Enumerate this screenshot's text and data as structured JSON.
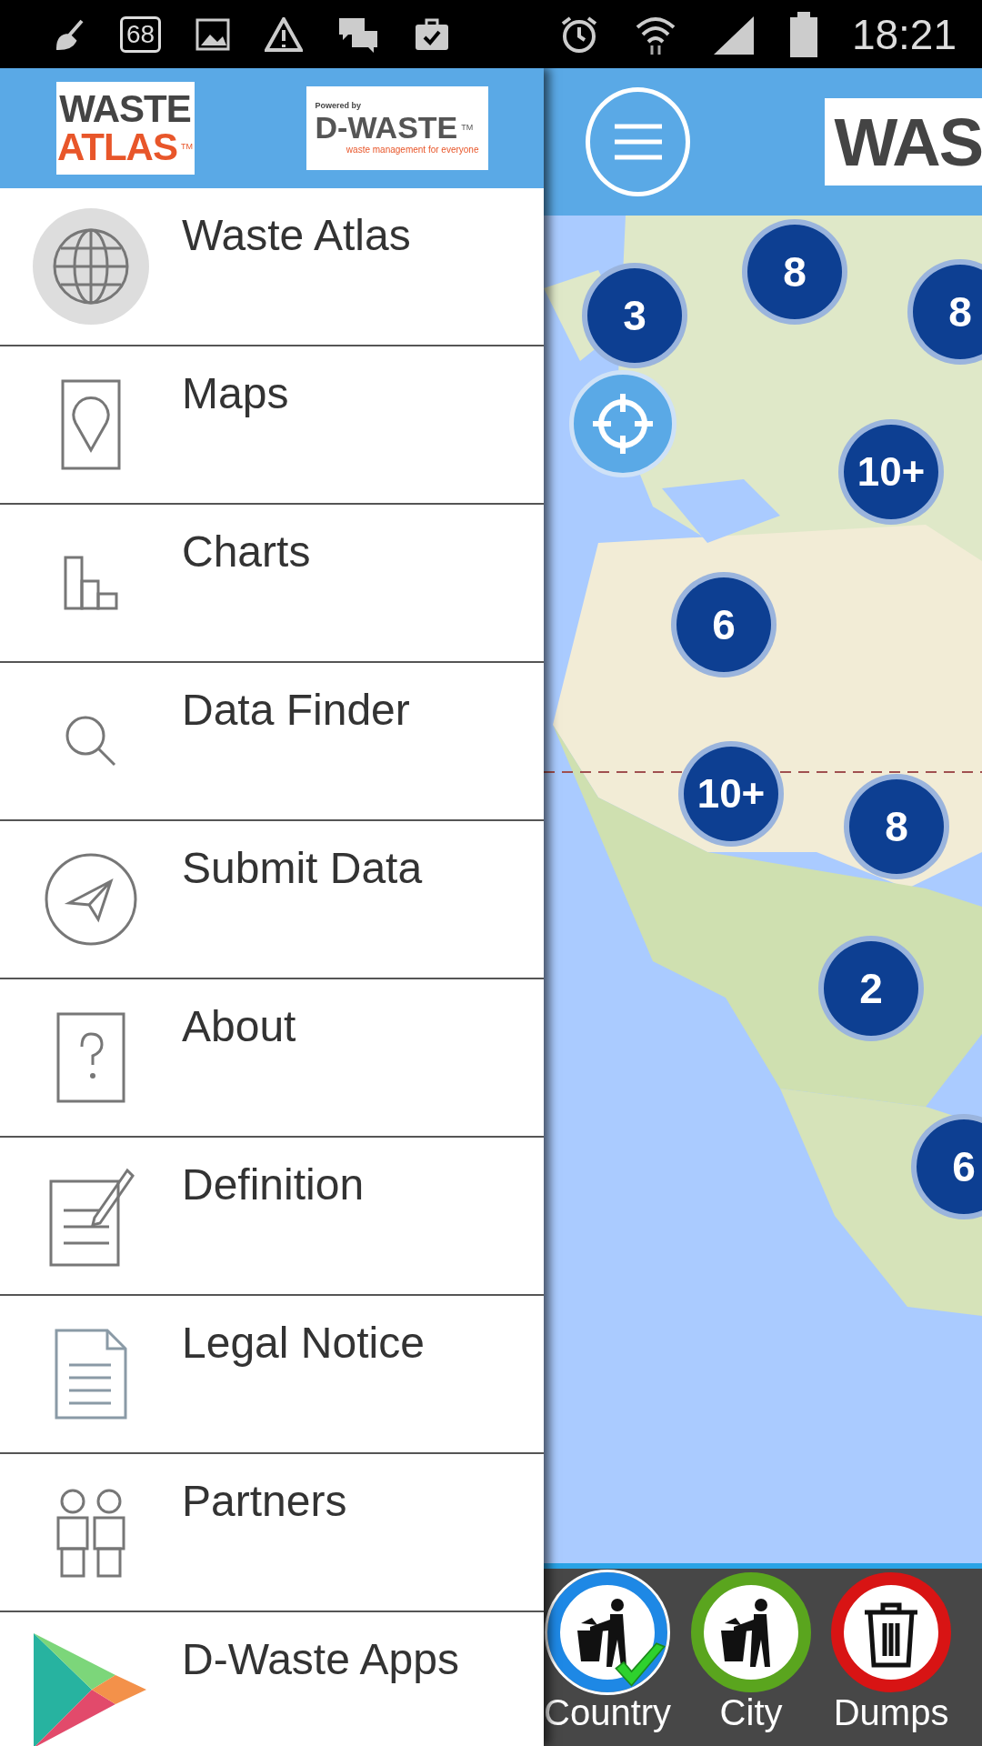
{
  "status_bar": {
    "notification_count": "68",
    "time": "18:21"
  },
  "drawer": {
    "logo_left": {
      "line1": "WASTE",
      "line2": "ATLAS",
      "mark": "TM"
    },
    "logo_right": {
      "powered": "Powered by",
      "name": "D-WASTE",
      "mark": "TM",
      "tagline": "waste management for everyone"
    },
    "items": [
      {
        "label": "Waste Atlas",
        "kind": "globe"
      },
      {
        "label": "Maps",
        "kind": "pin"
      },
      {
        "label": "Charts",
        "kind": "chart"
      },
      {
        "label": "Data Finder",
        "kind": "search"
      },
      {
        "label": "Submit Data",
        "kind": "send"
      },
      {
        "label": "About",
        "kind": "question"
      },
      {
        "label": "Definition",
        "kind": "edit"
      },
      {
        "label": "Legal Notice",
        "kind": "document"
      },
      {
        "label": "Partners",
        "kind": "people"
      },
      {
        "label": "D-Waste Apps",
        "kind": "play"
      }
    ]
  },
  "map_header": {
    "logo_text": "WAS"
  },
  "map": {
    "kind": "picture",
    "clusters": [
      {
        "count": "3"
      },
      {
        "count": "8"
      },
      {
        "count": "8"
      },
      {
        "count": "10+"
      },
      {
        "count": "6"
      },
      {
        "count": "10+"
      },
      {
        "count": "8"
      },
      {
        "count": "2"
      },
      {
        "count": "6"
      }
    ]
  },
  "filters": [
    {
      "label": "Country",
      "color": "#1e88e5",
      "selected": true,
      "kind": "litter"
    },
    {
      "label": "City",
      "color": "#5aa51e",
      "selected": false,
      "kind": "litter"
    },
    {
      "label": "Dumps",
      "color": "#d81414",
      "selected": false,
      "kind": "bin"
    }
  ]
}
